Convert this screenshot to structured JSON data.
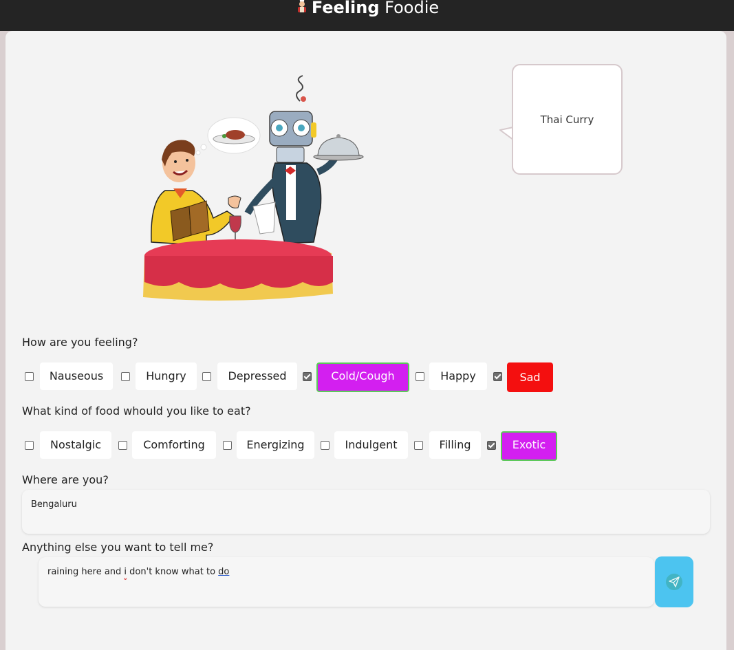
{
  "header": {
    "logo_icon": "chef-icon",
    "title_bold": "Feeling",
    "title_rest": "Foodie"
  },
  "illustration": {
    "icon": "restaurant-robot-waiter-illustration"
  },
  "suggestion": {
    "text": "Thai Curry"
  },
  "feeling": {
    "question": "How are you feeling?",
    "options": [
      {
        "label": "Nauseous",
        "checked": false
      },
      {
        "label": "Hungry",
        "checked": false
      },
      {
        "label": "Depressed",
        "checked": false
      },
      {
        "label": "Cold/Cough",
        "checked": true
      },
      {
        "label": "Happy",
        "checked": false
      },
      {
        "label": "Sad",
        "checked": true
      }
    ]
  },
  "food": {
    "question": "What kind of food whould you like to eat?",
    "options": [
      {
        "label": "Nostalgic",
        "checked": false
      },
      {
        "label": "Comforting",
        "checked": false
      },
      {
        "label": "Energizing",
        "checked": false
      },
      {
        "label": "Indulgent",
        "checked": false
      },
      {
        "label": "Filling",
        "checked": false
      },
      {
        "label": "Exotic",
        "checked": true
      }
    ]
  },
  "location": {
    "question": "Where are you?",
    "value": "Bengaluru"
  },
  "notes": {
    "question": "Anything else you want to tell me?",
    "value_part1": "raining here and ",
    "value_part2": "i",
    "value_part3": " don't know what to ",
    "value_part4": "do"
  },
  "send_button": {
    "icon": "send-icon"
  },
  "colors": {
    "topbar": "#242424",
    "selected_purple": "#d31ff0",
    "selected_red": "#f40f0f",
    "send_button": "#4cc4f0"
  }
}
